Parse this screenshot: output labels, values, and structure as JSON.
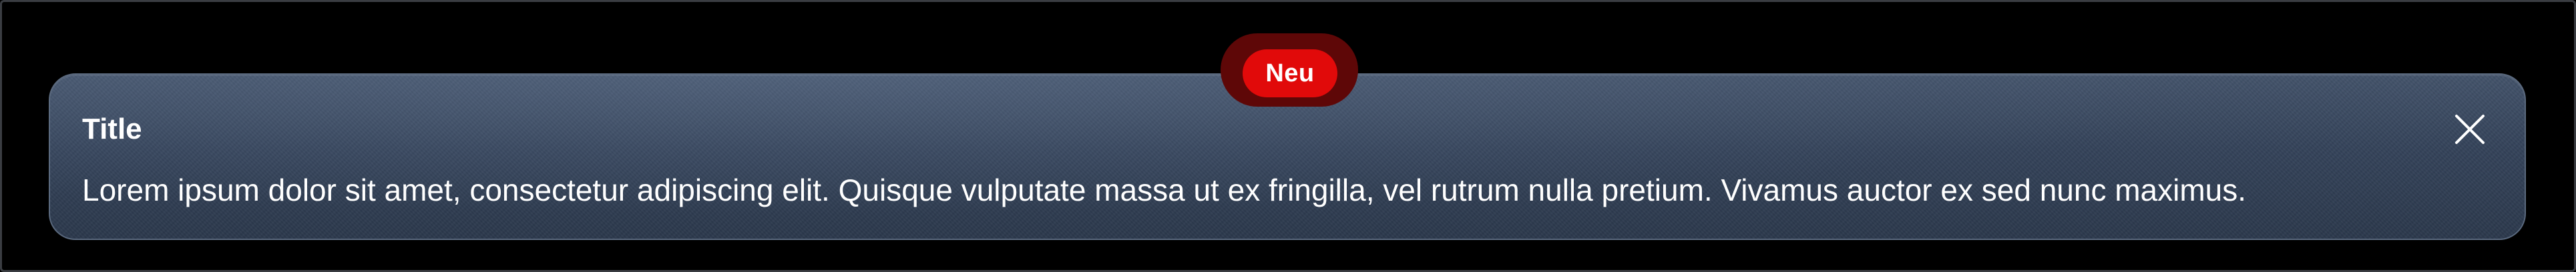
{
  "badge": {
    "label": "Neu"
  },
  "notification": {
    "title": "Title",
    "message": "Lorem ipsum dolor sit amet, consectetur adipiscing elit. Quisque vulputate massa ut ex fringilla, vel rutrum nulla pretium. Vivamus auctor ex sed nunc maximus.",
    "close_icon": "close-icon"
  },
  "colors": {
    "background": "#000000",
    "card": "#3a4960",
    "badge": "#e10a0a",
    "badge_halo": "#5e0707",
    "text": "#ffffff"
  }
}
